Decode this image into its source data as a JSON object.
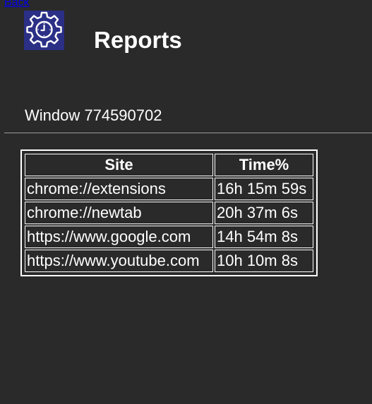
{
  "nav": {
    "back_label": "Back"
  },
  "header": {
    "logo_icon": "gear-clock-icon",
    "title": "Reports"
  },
  "window": {
    "label": "Window 774590702"
  },
  "report_table": {
    "columns": [
      "Site",
      "Time%"
    ],
    "rows": [
      {
        "site": "chrome://extensions",
        "time": "16h 15m 59s"
      },
      {
        "site": "chrome://newtab",
        "time": "20h 37m 6s"
      },
      {
        "site": "https://www.google.com",
        "time": "14h 54m 8s"
      },
      {
        "site": "https://www.youtube.com",
        "time": "10h 10m 8s"
      }
    ]
  },
  "colors": {
    "background": "#2a2a2a",
    "logo_background": "#2b2f86",
    "link": "#0000ee",
    "text": "#ffffff"
  }
}
